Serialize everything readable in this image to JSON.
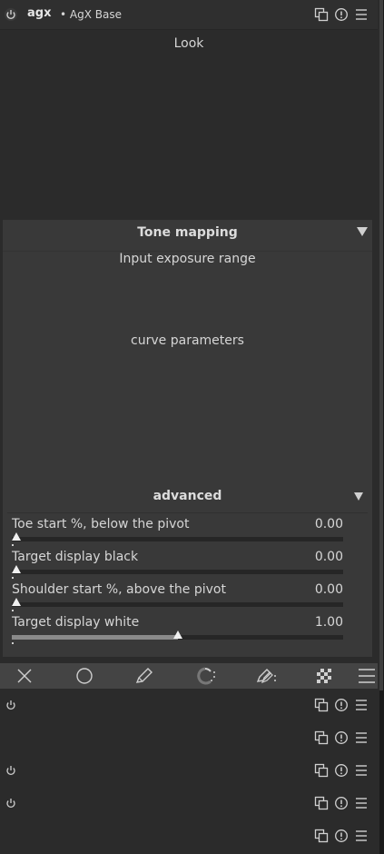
{
  "module": {
    "name": "agx",
    "preset": "• AgX Base"
  },
  "sections": {
    "look": "Look",
    "tone_mapping": "Tone mapping",
    "input_exposure_range": "Input exposure range",
    "curve_parameters": "curve parameters",
    "advanced": "advanced"
  },
  "sliders": [
    {
      "label": "Toe start %, below the pivot",
      "value": "0.00",
      "position": 0.0
    },
    {
      "label": "Target display black",
      "value": "0.00",
      "position": 0.0
    },
    {
      "label": "Shoulder start %, above the pivot",
      "value": "0.00",
      "position": 0.0
    },
    {
      "label": "Target display white",
      "value": "1.00",
      "position": 0.5
    }
  ],
  "toolbar": {
    "icons": [
      "close-icon",
      "circle-icon",
      "pencil-icon",
      "brush-refine-icon",
      "pencil-refine-icon",
      "checkerboard-icon",
      "menu-icon"
    ]
  },
  "collapsed_modules": [
    {
      "has_power": true
    },
    {
      "has_power": false
    },
    {
      "has_power": true
    },
    {
      "has_power": true
    },
    {
      "has_power": false
    }
  ],
  "colors": {
    "background": "#2b2b2b",
    "panel": "#393939",
    "toolbar": "#444444",
    "text": "#d6d6d6"
  }
}
